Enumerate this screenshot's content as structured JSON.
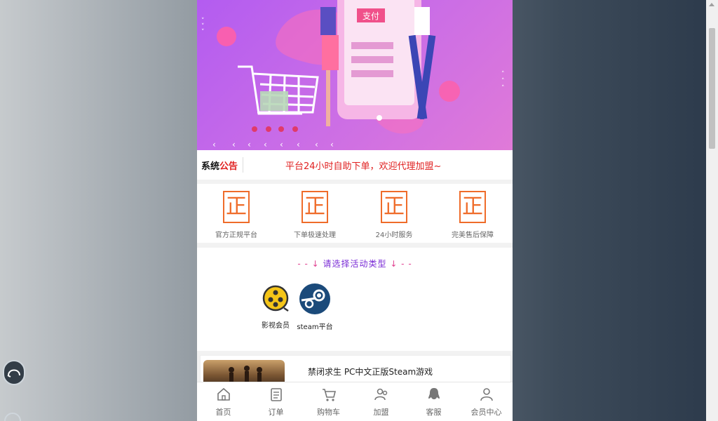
{
  "notice": {
    "title_black": "系统",
    "title_red": "公告",
    "text": "平台24小时自助下单，欢迎代理加盟~"
  },
  "banner": {
    "pay_label": "支付"
  },
  "features": [
    {
      "badge": "正",
      "label": "官方正规平台"
    },
    {
      "badge": "正",
      "label": "下单极速处理"
    },
    {
      "badge": "正",
      "label": "24小时服务"
    },
    {
      "badge": "正",
      "label": "完美售后保障"
    }
  ],
  "choose": {
    "dash_left": "- - ↓ ",
    "title": "请选择活动类型",
    "dash_right": " ↓ - -",
    "categories": [
      {
        "label": "影视会员",
        "icon": "film-reel-icon"
      },
      {
        "label": "steam平台",
        "icon": "steam-icon"
      }
    ]
  },
  "product": {
    "title": "禁闭求生 PC中文正版Steam游戏"
  },
  "tabbar": [
    {
      "label": "首页",
      "icon": "home-icon"
    },
    {
      "label": "订单",
      "icon": "order-icon"
    },
    {
      "label": "购物车",
      "icon": "cart-icon"
    },
    {
      "label": "加盟",
      "icon": "join-icon"
    },
    {
      "label": "客服",
      "icon": "service-icon"
    },
    {
      "label": "会员中心",
      "icon": "user-icon"
    }
  ],
  "colors": {
    "accent_red": "#e02020",
    "badge_orange": "#ef6c2a",
    "title_purple": "#7a2bd6",
    "banner_purple": "#b35cf0"
  }
}
